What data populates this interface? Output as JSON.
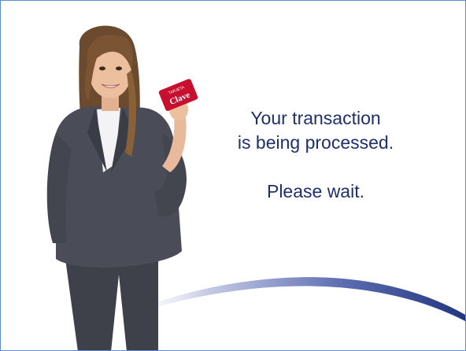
{
  "screen": {
    "message": {
      "line1": "Your transaction",
      "line2": "is being processed.",
      "line3": "Please wait."
    },
    "card": {
      "brand_small": "TARJETA",
      "brand": "Clave"
    }
  },
  "colors": {
    "border": "#5b8fc9",
    "text": "#1f2f6d",
    "swoosh": "#2b3f8f",
    "card_red": "#c8102e",
    "suit": "#4a4d57"
  }
}
